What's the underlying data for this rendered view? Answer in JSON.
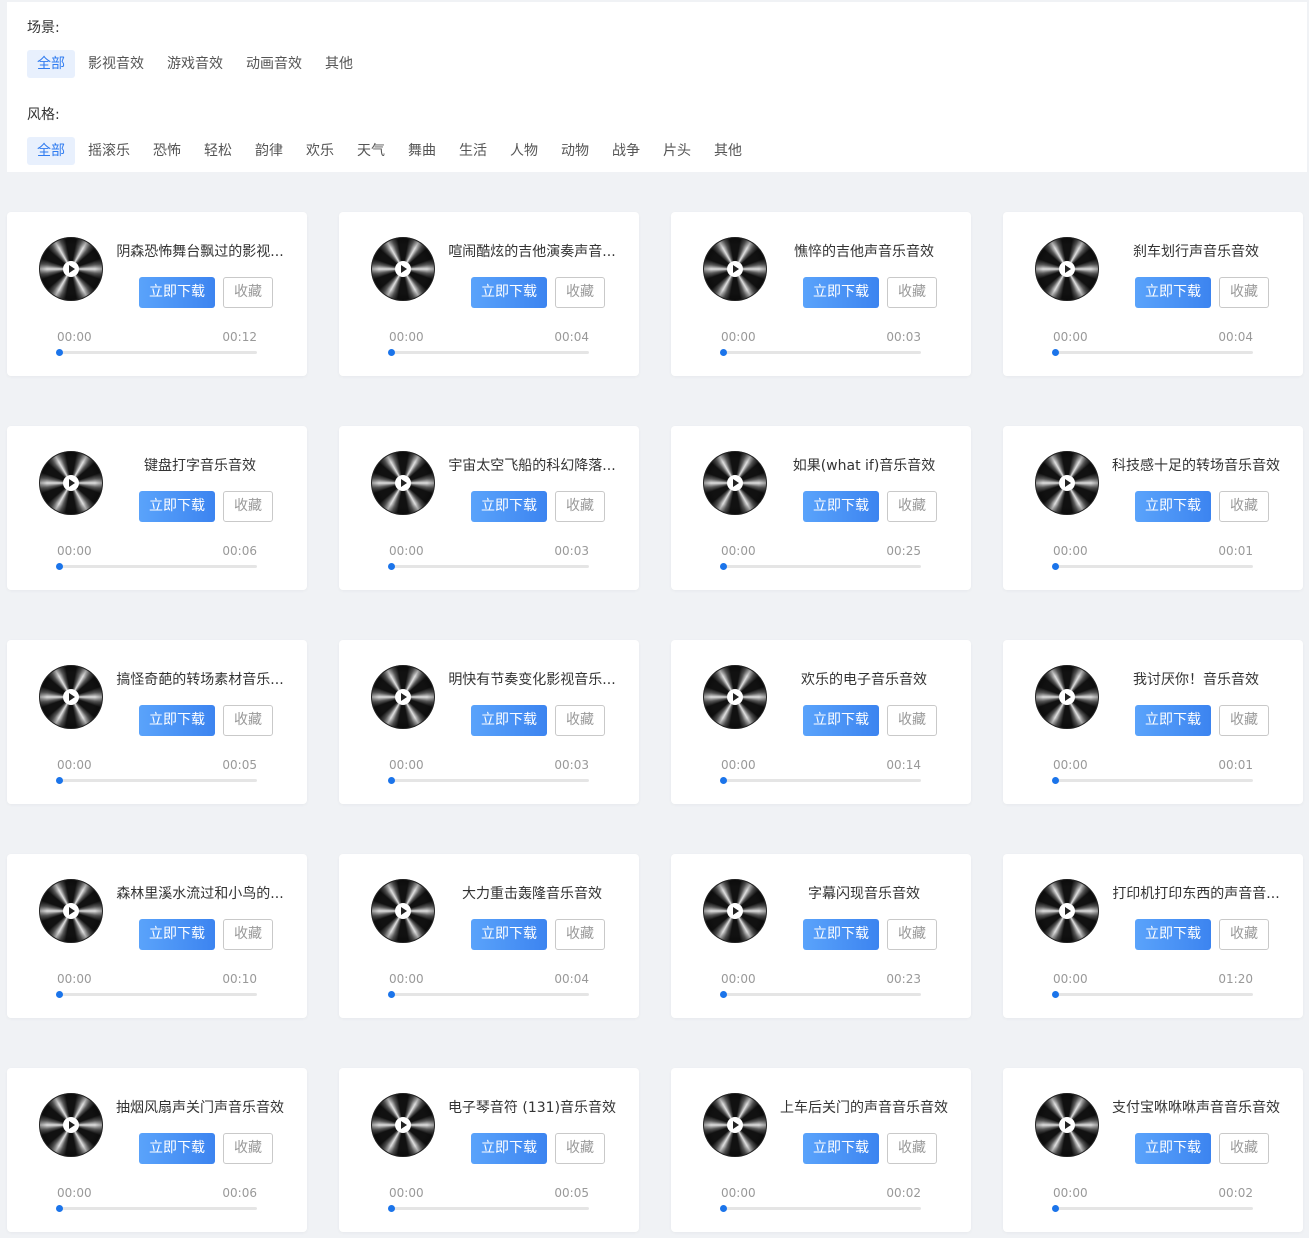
{
  "filters": {
    "scene": {
      "label": "场景:",
      "options": [
        "全部",
        "影视音效",
        "游戏音效",
        "动画音效",
        "其他"
      ],
      "active": 0
    },
    "style": {
      "label": "风格:",
      "options": [
        "全部",
        "摇滚乐",
        "恐怖",
        "轻松",
        "韵律",
        "欢乐",
        "天气",
        "舞曲",
        "生活",
        "人物",
        "动物",
        "战争",
        "片头",
        "其他"
      ],
      "active": 0
    }
  },
  "buttons": {
    "download": "立即下载",
    "favorite": "收藏"
  },
  "colors": {
    "accent": "#2f7bf0",
    "download_start": "#5aa3fb",
    "download_end": "#3c84f0"
  },
  "cards": [
    {
      "title": "阴森恐怖舞台飘过的影视...",
      "current": "00:00",
      "duration": "00:12",
      "progress": 0
    },
    {
      "title": "喧闹酷炫的吉他演奏声音...",
      "current": "00:00",
      "duration": "00:04",
      "progress": 0
    },
    {
      "title": "憔悴的吉他声音乐音效",
      "current": "00:00",
      "duration": "00:03",
      "progress": 0
    },
    {
      "title": "刹车划行声音乐音效",
      "current": "00:00",
      "duration": "00:04",
      "progress": 0
    },
    {
      "title": "键盘打字音乐音效",
      "current": "00:00",
      "duration": "00:06",
      "progress": 0
    },
    {
      "title": "宇宙太空飞船的科幻降落...",
      "current": "00:00",
      "duration": "00:03",
      "progress": 0
    },
    {
      "title": "如果(what if)音乐音效",
      "current": "00:00",
      "duration": "00:25",
      "progress": 0
    },
    {
      "title": "科技感十足的转场音乐音效",
      "current": "00:00",
      "duration": "00:01",
      "progress": 0
    },
    {
      "title": "搞怪奇葩的转场素材音乐...",
      "current": "00:00",
      "duration": "00:05",
      "progress": 0
    },
    {
      "title": "明快有节奏变化影视音乐...",
      "current": "00:00",
      "duration": "00:03",
      "progress": 0
    },
    {
      "title": "欢乐的电子音乐音效",
      "current": "00:00",
      "duration": "00:14",
      "progress": 0
    },
    {
      "title": "我讨厌你！音乐音效",
      "current": "00:00",
      "duration": "00:01",
      "progress": 0
    },
    {
      "title": "森林里溪水流过和小鸟的...",
      "current": "00:00",
      "duration": "00:10",
      "progress": 0
    },
    {
      "title": "大力重击轰隆音乐音效",
      "current": "00:00",
      "duration": "00:04",
      "progress": 0
    },
    {
      "title": "字幕闪现音乐音效",
      "current": "00:00",
      "duration": "00:23",
      "progress": 0
    },
    {
      "title": "打印机打印东西的声音音...",
      "current": "00:00",
      "duration": "01:20",
      "progress": 0
    },
    {
      "title": "抽烟风扇声关门声音乐音效",
      "current": "00:00",
      "duration": "00:06",
      "progress": 0
    },
    {
      "title": "电子琴音符 (131)音乐音效",
      "current": "00:00",
      "duration": "00:05",
      "progress": 0
    },
    {
      "title": "上车后关门的声音音乐音效",
      "current": "00:00",
      "duration": "00:02",
      "progress": 0
    },
    {
      "title": "支付宝咻咻咻声音音乐音效",
      "current": "00:00",
      "duration": "00:02",
      "progress": 0
    }
  ]
}
